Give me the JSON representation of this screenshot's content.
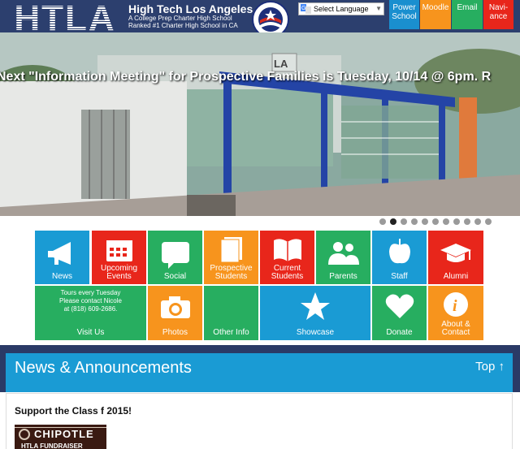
{
  "header": {
    "logo_text": "HTLA",
    "site_name": "High Tech Los Angeles",
    "tagline_1": "A College Prep Charter High School",
    "tagline_2": "Ranked #1 Charter High School in CA",
    "translate_label": "Select Language"
  },
  "quick_links": [
    {
      "label_1": "Power",
      "label_2": "School",
      "color": "#1a8fcf"
    },
    {
      "label_1": "Moodle",
      "label_2": "",
      "color": "#f7941d"
    },
    {
      "label_1": "Email",
      "label_2": "",
      "color": "#27ae60"
    },
    {
      "label_1": "Navi-",
      "label_2": "ance",
      "color": "#e8261b"
    }
  ],
  "ticker": "Next \"Information Meeting\" for Prospective Families is Tuesday, 10/14 @ 6pm. R",
  "hero": {
    "sign_text": "LA"
  },
  "slider": {
    "count": 11,
    "active": 1
  },
  "tiles": {
    "news": "News",
    "events_1": "Upcoming",
    "events_2": "Events",
    "social": "Social",
    "prospective_1": "Prospective",
    "prospective_2": "Students",
    "current_1": "Current",
    "current_2": "Students",
    "parents": "Parents",
    "staff": "Staff",
    "alumni": "Alumni",
    "visit_info_1": "Tours every Tuesday",
    "visit_info_2": "Please contact Nicole",
    "visit_info_3": "at (818) 609-2686.",
    "visit": "Visit Us",
    "photos": "Photos",
    "other": "Other Info",
    "showcase": "Showcase",
    "donate": "Donate",
    "about_1": "About &",
    "about_2": "Contact"
  },
  "news": {
    "heading": "News & Announcements",
    "top_link": "Top ↑",
    "post_title": "Support the Class f 2015!",
    "thumb_line_1": "CHIPOTLE",
    "thumb_line_2": "HTLA FUNDRAISER"
  },
  "colors": {
    "blue": "#1a9bd4",
    "red": "#e8261b",
    "green": "#27ae60",
    "orange": "#f7941d"
  }
}
